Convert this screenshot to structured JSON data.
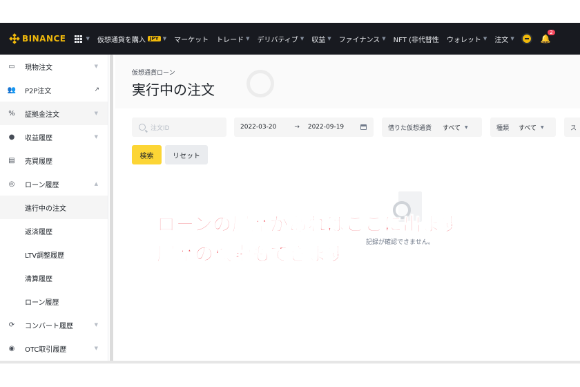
{
  "topbar": {
    "brand": "BINANCE",
    "nav": [
      {
        "label": "仮想通貨を購入",
        "badge": "JPY",
        "caret": true
      },
      {
        "label": "マーケット",
        "caret": false
      },
      {
        "label": "トレード",
        "caret": true
      },
      {
        "label": "デリバティブ",
        "caret": true
      },
      {
        "label": "収益",
        "caret": true
      },
      {
        "label": "ファイナンス",
        "caret": true
      },
      {
        "label": "NFT (非代替性",
        "caret": false
      },
      {
        "label": "ウォレット",
        "caret": true
      },
      {
        "label": "注文",
        "caret": true
      }
    ],
    "notification_count": "2"
  },
  "sidebar": {
    "items": [
      {
        "label": "現物注文",
        "icon": "wallet-icon",
        "caret": true
      },
      {
        "label": "P2P注文",
        "icon": "users-icon",
        "external": true
      },
      {
        "label": "証拠金注文",
        "icon": "percent-icon",
        "caret": true
      },
      {
        "label": "収益履歴",
        "icon": "piggy-bank-icon",
        "caret": true
      },
      {
        "label": "売買履歴",
        "icon": "document-icon"
      },
      {
        "label": "ローン履歴",
        "icon": "loan-icon",
        "caret": true
      },
      {
        "label": "進行中の注文",
        "sub": true,
        "active": true
      },
      {
        "label": "返済履歴",
        "sub": true
      },
      {
        "label": "LTV調整履歴",
        "sub": true
      },
      {
        "label": "清算履歴",
        "sub": true
      },
      {
        "label": "ローン履歴",
        "sub": true
      },
      {
        "label": "コンバート履歴",
        "icon": "convert-icon",
        "caret": true
      },
      {
        "label": "OTC取引履歴",
        "icon": "otc-icon",
        "caret": true
      }
    ]
  },
  "page": {
    "breadcrumb": "仮想通貨ローン",
    "title": "実行中の注文"
  },
  "filters": {
    "search_placeholder": "注文ID",
    "date_from": "2022-03-20",
    "date_arrow": "→",
    "date_to": "2022-09-19",
    "coin_label": "借りた仮想通貨",
    "coin_value": "すべて",
    "type_label": "種類",
    "type_value": "すべて",
    "more_label": "ス"
  },
  "buttons": {
    "search": "検索",
    "reset": "リセット"
  },
  "empty": {
    "message": "記録が確認できません。"
  },
  "overlay": {
    "line1": "ローンの履歴があればここに出ます。",
    "line2": "履歴の検索もできます。"
  },
  "colors": {
    "brand": "#f0b90b",
    "topbar_bg": "#181a20",
    "search_button": "#fcd535",
    "overlay_text": "#f0505a"
  }
}
